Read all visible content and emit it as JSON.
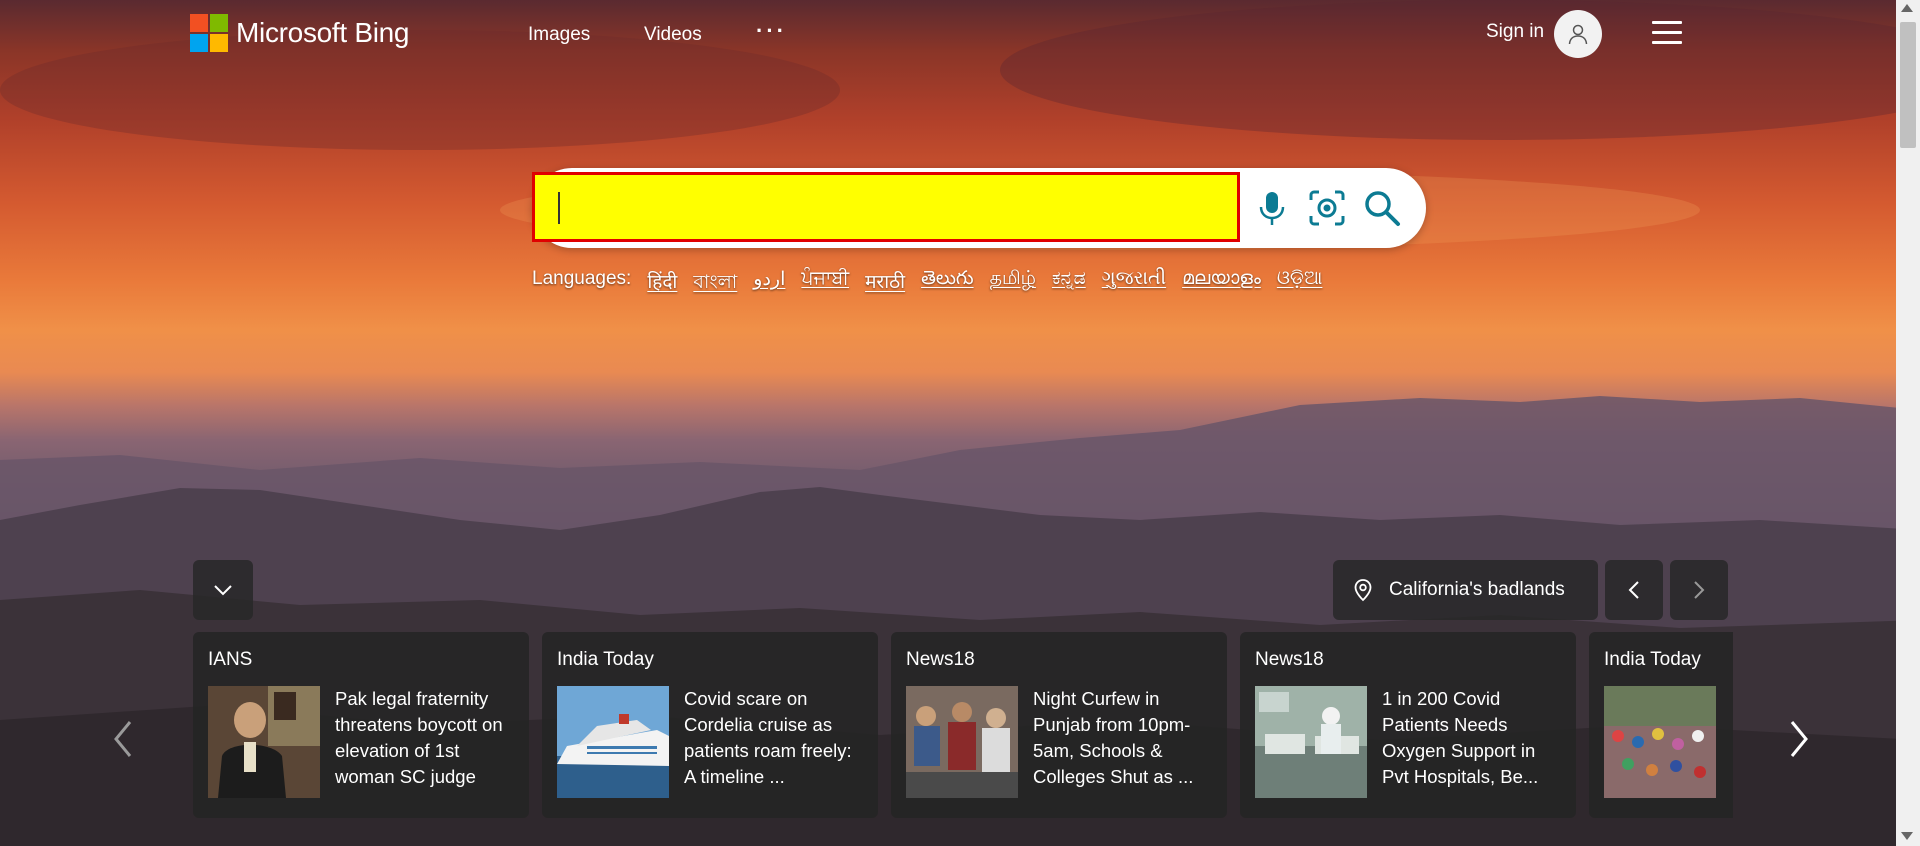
{
  "colors": {
    "logo_red": "#f25022",
    "logo_green": "#7fba00",
    "logo_blue": "#00a4ef",
    "logo_yellow": "#ffb900",
    "search_highlight": "#ffff00",
    "search_border": "#e00000",
    "icon_teal": "#0c7b93"
  },
  "header": {
    "logo_text": "Microsoft Bing",
    "nav": [
      "Images",
      "Videos"
    ],
    "more_label": "···",
    "sign_in": "Sign in"
  },
  "search": {
    "value": "",
    "placeholder": "",
    "icons": [
      "microphone-icon",
      "visual-search-icon",
      "search-icon"
    ]
  },
  "languages": {
    "label": "Languages:",
    "items": [
      "हिंदी",
      "বাংলা",
      "اردو",
      "ਪੰਜਾਬੀ",
      "मराठी",
      "తెలుగు",
      "தமிழ்",
      "ಕನ್ನಡ",
      "ગુજરાતી",
      "മലയാളം",
      "ଓଡ଼ିଆ"
    ]
  },
  "image_info": {
    "location": "California's badlands"
  },
  "news": [
    {
      "source": "IANS",
      "headline": "Pak legal fraternity threatens boycott on elevation of 1st woman SC judge"
    },
    {
      "source": "India Today",
      "headline": "Covid scare on Cordelia cruise as patients roam freely: A timeline ..."
    },
    {
      "source": "News18",
      "headline": "Night Curfew in Punjab from 10pm-5am, Schools & Colleges Shut as ..."
    },
    {
      "source": "News18",
      "headline": "1 in 200 Covid Patients Needs Oxygen Support in Pvt Hospitals, Be..."
    },
    {
      "source": "India Today",
      "headline": ""
    }
  ]
}
